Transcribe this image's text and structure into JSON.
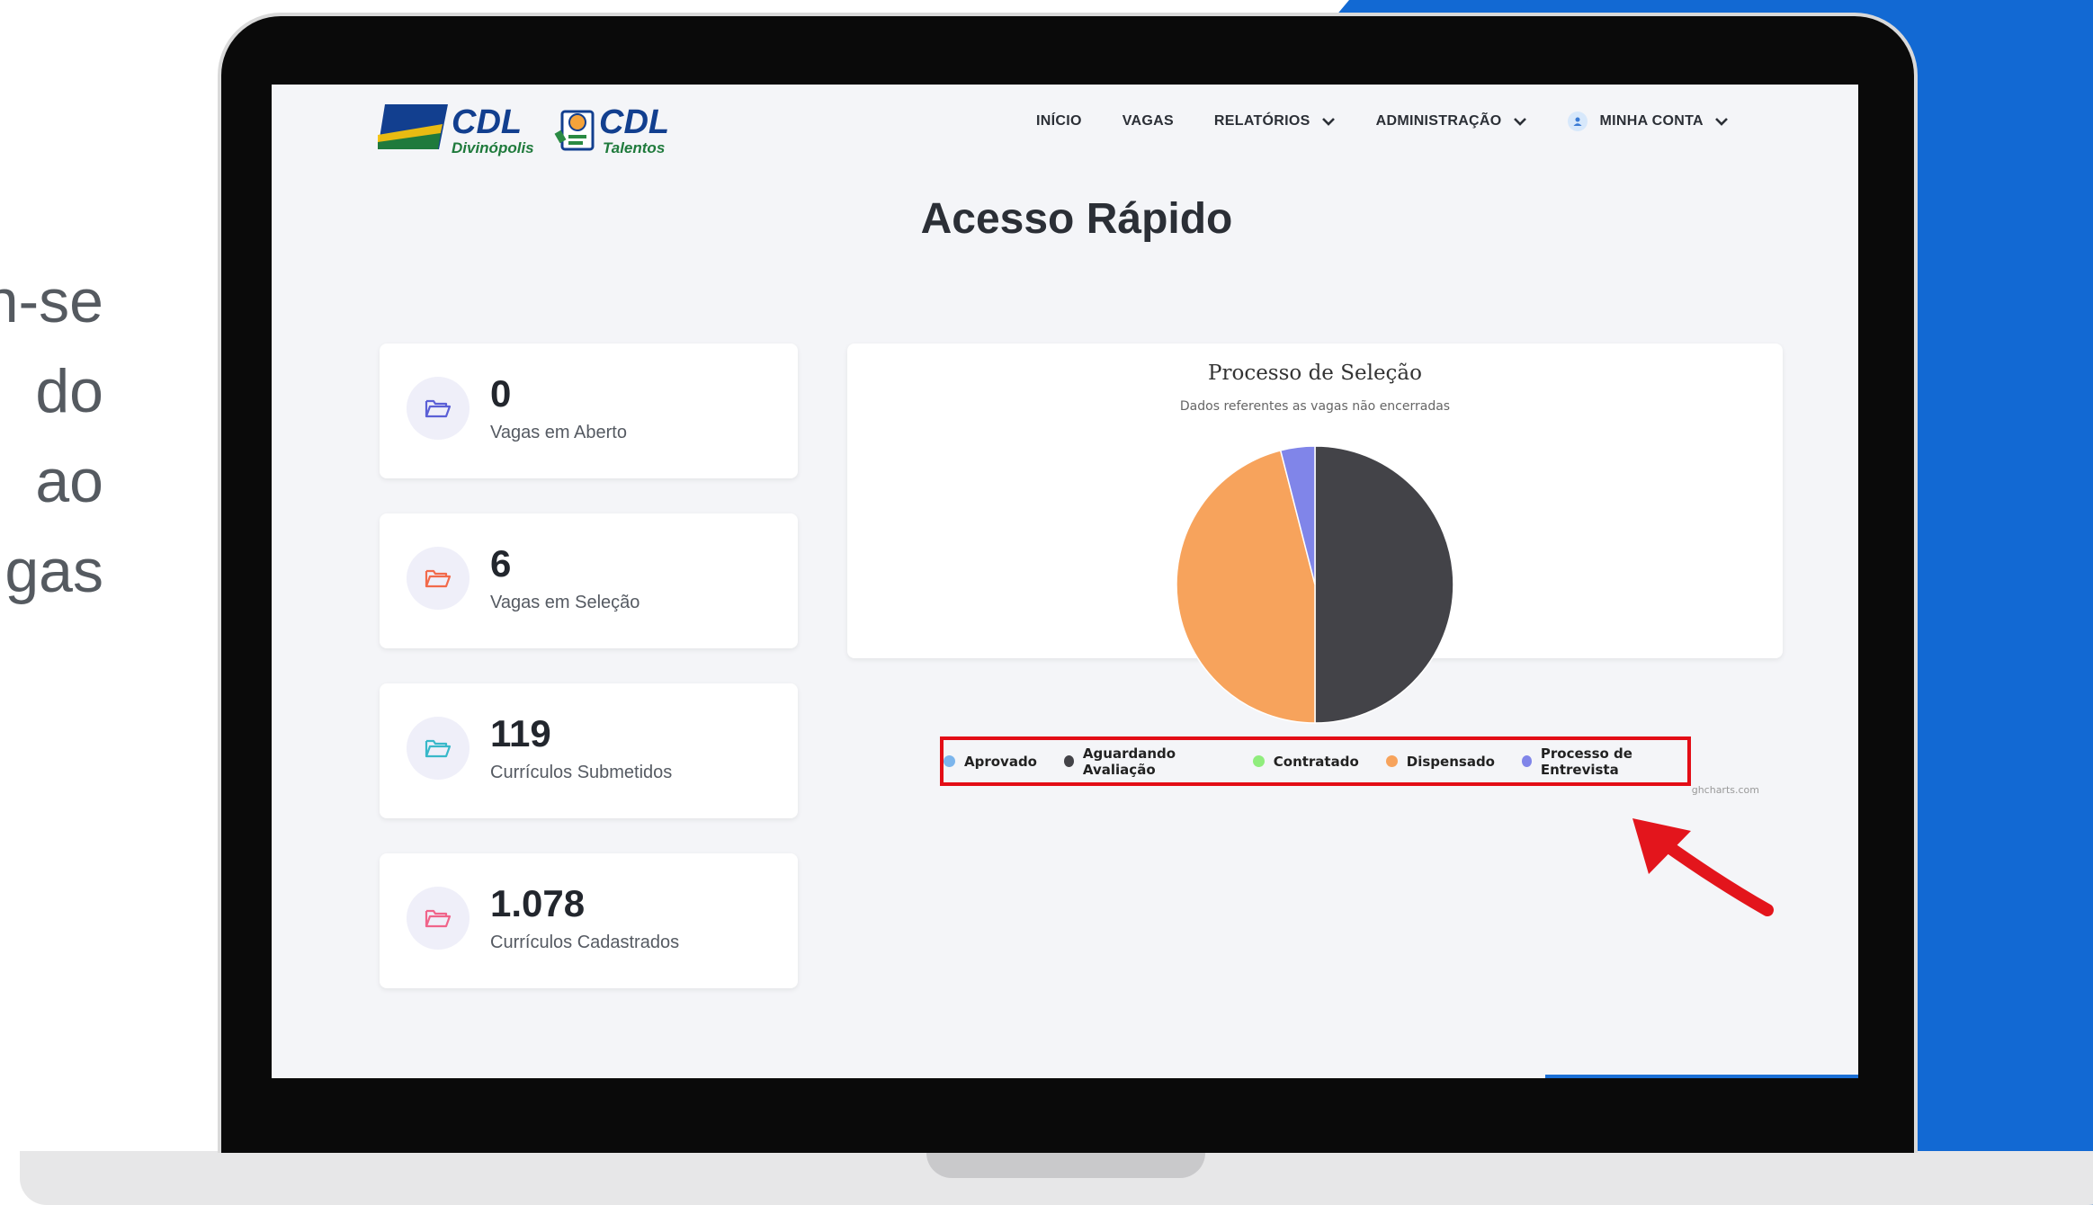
{
  "side_text": [
    "n-se",
    "do",
    "ao",
    "gas"
  ],
  "header": {
    "logo_primary": "CDL",
    "logo_primary_sub": "Divinópolis",
    "logo_secondary": "CDL",
    "logo_secondary_sub": "Talentos",
    "nav": {
      "inicio": "INÍCIO",
      "vagas": "VAGAS",
      "relatorios": "RELATÓRIOS",
      "administracao": "ADMINISTRAÇÃO",
      "minha_conta": "MINHA CONTA"
    }
  },
  "page_title": "Acesso Rápido",
  "cards": [
    {
      "value": "0",
      "label": "Vagas em Aberto",
      "icon": "folder-open-icon",
      "color": "#5b5fd6"
    },
    {
      "value": "6",
      "label": "Vagas em Seleção",
      "icon": "folder-open-icon",
      "color": "#f26a4b"
    },
    {
      "value": "119",
      "label": "Currículos Submetidos",
      "icon": "folder-open-icon",
      "color": "#38b8c9"
    },
    {
      "value": "1.078",
      "label": "Currículos Cadastrados",
      "icon": "folder-open-icon",
      "color": "#f0648a"
    }
  ],
  "chart_data": {
    "type": "pie",
    "title": "Processo de Seleção",
    "subtitle": "Dados referentes as vagas não encerradas",
    "series": [
      {
        "name": "Aprovado",
        "value": 0,
        "color": "#7cb5ec"
      },
      {
        "name": "Aguardando Avaliação",
        "value": 50,
        "color": "#434348"
      },
      {
        "name": "Contratado",
        "value": 0,
        "color": "#90ed7d"
      },
      {
        "name": "Dispensado",
        "value": 46,
        "color": "#f7a35c"
      },
      {
        "name": "Processo de Entrevista",
        "value": 4,
        "color": "#8085e9"
      }
    ],
    "credits": "ghcharts.com"
  }
}
